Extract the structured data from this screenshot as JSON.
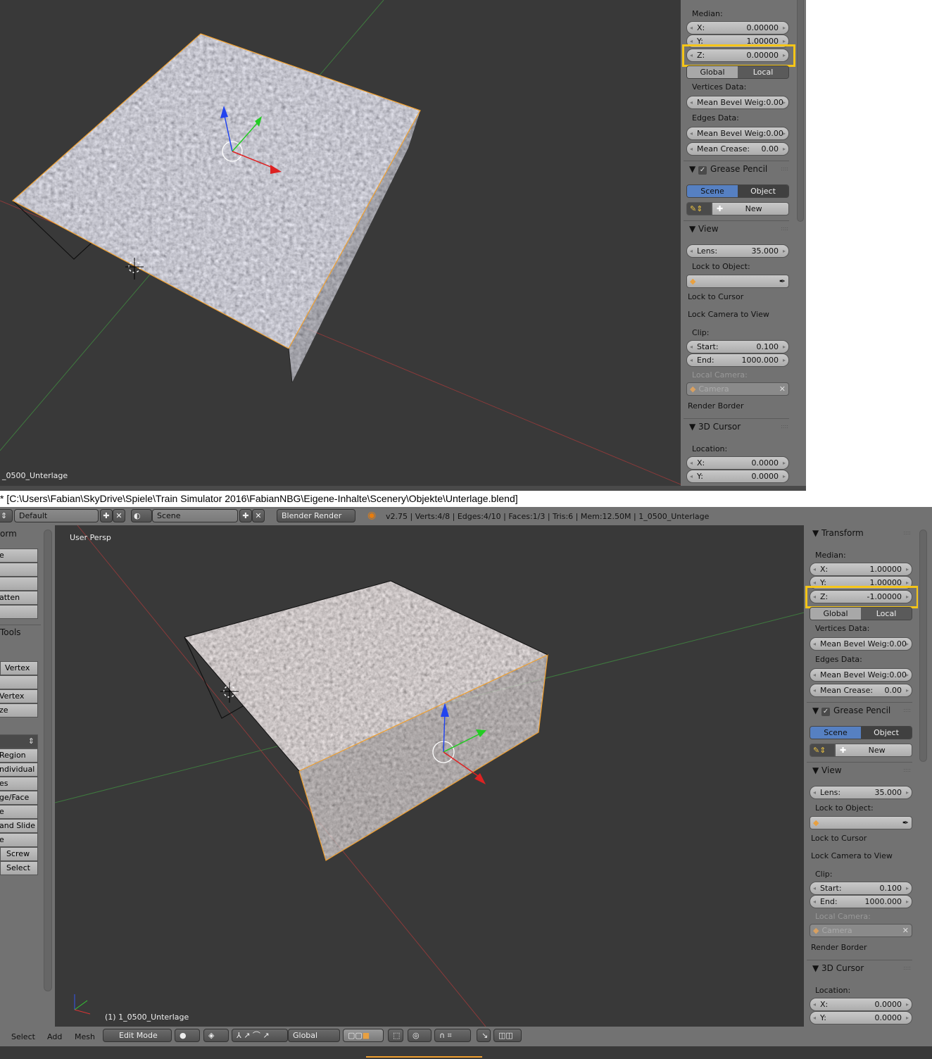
{
  "top_window": {
    "object_name": "_0500_Unterlage",
    "panel": [
      {
        "type": "label",
        "text": "Median:"
      },
      {
        "type": "field",
        "label": "X:",
        "value": "0.00000"
      },
      {
        "type": "field",
        "label": "Y:",
        "value": "1.00000"
      },
      {
        "type": "field",
        "label": "Z:",
        "value": "0.00000",
        "highlight": true
      },
      {
        "type": "seg",
        "options": [
          "Global",
          "Local"
        ],
        "active": 1
      },
      {
        "type": "label",
        "text": "Vertices Data:"
      },
      {
        "type": "field",
        "label": "Mean Bevel Weig:",
        "value": "0.00"
      },
      {
        "type": "label",
        "text": "Edges Data:"
      },
      {
        "type": "field",
        "label": "Mean Bevel Weig:",
        "value": "0.00"
      },
      {
        "type": "field",
        "label": "Mean Crease:",
        "value": "0.00"
      },
      {
        "type": "header",
        "text": "Grease Pencil",
        "check": true
      },
      {
        "type": "seg",
        "options": [
          "Scene",
          "Object"
        ],
        "active": 0,
        "blue": true
      },
      {
        "type": "new",
        "text": "New"
      },
      {
        "type": "header",
        "text": "View"
      },
      {
        "type": "field",
        "label": "Lens:",
        "value": "35.000"
      },
      {
        "type": "label",
        "text": "Lock to Object:"
      },
      {
        "type": "object",
        "text": ""
      },
      {
        "type": "check",
        "text": "Lock to Cursor"
      },
      {
        "type": "check",
        "text": "Lock Camera to View"
      },
      {
        "type": "label",
        "text": "Clip:"
      },
      {
        "type": "field",
        "label": "Start:",
        "value": "0.100"
      },
      {
        "type": "field",
        "label": "End:",
        "value": "1000.000"
      },
      {
        "type": "dimlabel",
        "text": "Local Camera:"
      },
      {
        "type": "camera",
        "text": "Camera"
      },
      {
        "type": "check",
        "text": "Render Border"
      },
      {
        "type": "header",
        "text": "3D Cursor"
      },
      {
        "type": "label",
        "text": "Location:"
      },
      {
        "type": "field",
        "label": "X:",
        "value": "0.0000"
      },
      {
        "type": "field",
        "label": "Y:",
        "value": "0.0000"
      }
    ]
  },
  "title_bar": "* [C:\\Users\\Fabian\\SkyDrive\\Spiele\\Train Simulator 2016\\FabianNBG\\Eigene-Inhalte\\Scenery\\Objekte\\Unterlage.blend]",
  "info_header": {
    "layout": "Default",
    "scene": "Scene",
    "render_engine": "Blender Render",
    "stats": "v2.75 | Verts:4/8 | Edges:4/10 | Faces:1/3 | Tris:6 | Mem:12.50M | 1_0500_Unterlage"
  },
  "bottom_window": {
    "view_label": "User Persp",
    "object_label": "(1) 1_0500_Unterlage",
    "toolbar": {
      "header1": "orm",
      "buttons1": [
        "e",
        "",
        "",
        "atten",
        ""
      ],
      "header2": "Tools",
      "buttons2": [
        "Vertex",
        "",
        "Vertex",
        "ze"
      ],
      "buttons3": [
        "Region",
        "ndividual",
        "es",
        "ge/Face",
        "e",
        " and Slide",
        "e",
        "Screw",
        "Select"
      ]
    },
    "panel": [
      {
        "type": "header",
        "text": "Transform"
      },
      {
        "type": "label",
        "text": "Median:"
      },
      {
        "type": "field",
        "label": "X:",
        "value": "1.00000"
      },
      {
        "type": "field",
        "label": "Y:",
        "value": "1.00000"
      },
      {
        "type": "field",
        "label": "Z:",
        "value": "-1.00000",
        "highlight": true
      },
      {
        "type": "seg",
        "options": [
          "Global",
          "Local"
        ],
        "active": 1
      },
      {
        "type": "label",
        "text": "Vertices Data:"
      },
      {
        "type": "field",
        "label": "Mean Bevel Weig:",
        "value": "0.00"
      },
      {
        "type": "label",
        "text": "Edges Data:"
      },
      {
        "type": "field",
        "label": "Mean Bevel Weig:",
        "value": "0.00"
      },
      {
        "type": "field",
        "label": "Mean Crease:",
        "value": "0.00"
      },
      {
        "type": "header",
        "text": "Grease Pencil",
        "check": true
      },
      {
        "type": "seg",
        "options": [
          "Scene",
          "Object"
        ],
        "active": 0,
        "blue": true
      },
      {
        "type": "new",
        "text": "New"
      },
      {
        "type": "header",
        "text": "View"
      },
      {
        "type": "field",
        "label": "Lens:",
        "value": "35.000"
      },
      {
        "type": "label",
        "text": "Lock to Object:"
      },
      {
        "type": "object",
        "text": ""
      },
      {
        "type": "check",
        "text": "Lock to Cursor"
      },
      {
        "type": "check",
        "text": "Lock Camera to View"
      },
      {
        "type": "label",
        "text": "Clip:"
      },
      {
        "type": "field",
        "label": "Start:",
        "value": "0.100"
      },
      {
        "type": "field",
        "label": "End:",
        "value": "1000.000"
      },
      {
        "type": "dimlabel",
        "text": "Local Camera:"
      },
      {
        "type": "camera",
        "text": "Camera"
      },
      {
        "type": "check",
        "text": "Render Border"
      },
      {
        "type": "header",
        "text": "3D Cursor"
      },
      {
        "type": "label",
        "text": "Location:"
      },
      {
        "type": "field",
        "label": "X:",
        "value": "0.0000"
      },
      {
        "type": "field",
        "label": "Y:",
        "value": "0.0000"
      }
    ],
    "bottom_bar": {
      "menus": [
        "Select",
        "Add",
        "Mesh"
      ],
      "mode": "Edit Mode",
      "orientation": "Global"
    }
  },
  "colors": {
    "highlight": "#f5c518",
    "selection": "#f0a030",
    "viewport": "#393939",
    "panel": "#727272",
    "blue": "#5680c2"
  }
}
